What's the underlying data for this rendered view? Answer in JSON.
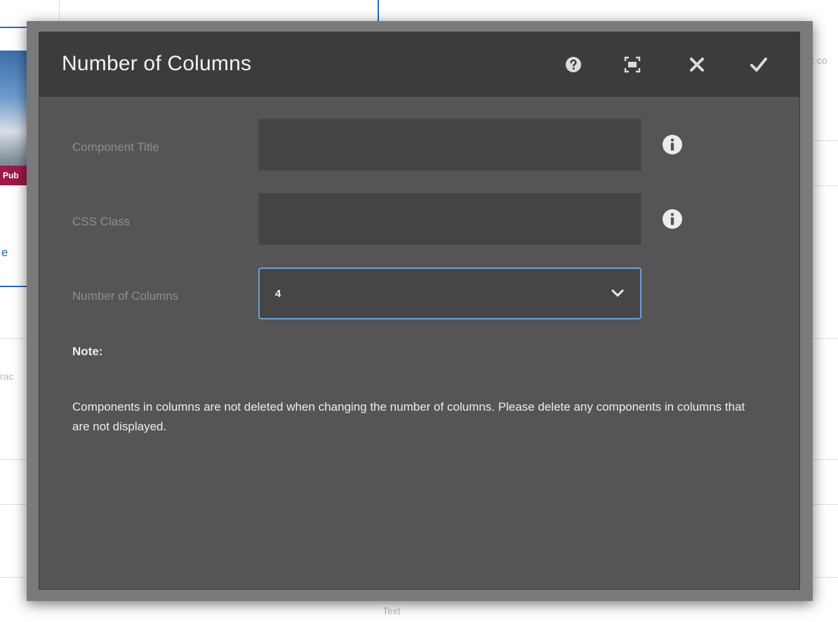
{
  "dialog": {
    "title": "Number of Columns",
    "header_buttons": [
      {
        "name": "help",
        "icon": "help-icon"
      },
      {
        "name": "fullscreen",
        "icon": "fullscreen-icon"
      },
      {
        "name": "close",
        "icon": "close-icon"
      },
      {
        "name": "done",
        "icon": "checkmark-icon"
      }
    ]
  },
  "form": {
    "component_title": {
      "label": "Component Title",
      "value": "",
      "info_icon": "info-icon"
    },
    "css_class": {
      "label": "CSS Class",
      "value": "",
      "info_icon": "info-icon"
    },
    "number_of_columns": {
      "label": "Number of Columns",
      "selected": "4",
      "icon": "chevron-down-icon"
    }
  },
  "note": {
    "heading": "Note:",
    "text": "Components in columns are not deleted when changing the number of columns. Please delete any components in columns that are not displayed."
  },
  "background": {
    "thumbnail_label": "Pub",
    "link_fragment": "e",
    "top_right_fragment": "t co",
    "left_fragment": "rac",
    "bottom_fragment": "Text"
  },
  "colors": {
    "dialog_body": "#555555",
    "dialog_header": "#3c3c3c",
    "focus_border": "#6f9fd8",
    "background_accent": "#2a6bc2",
    "thumbnail_label_bg": "#9c1a4a"
  }
}
